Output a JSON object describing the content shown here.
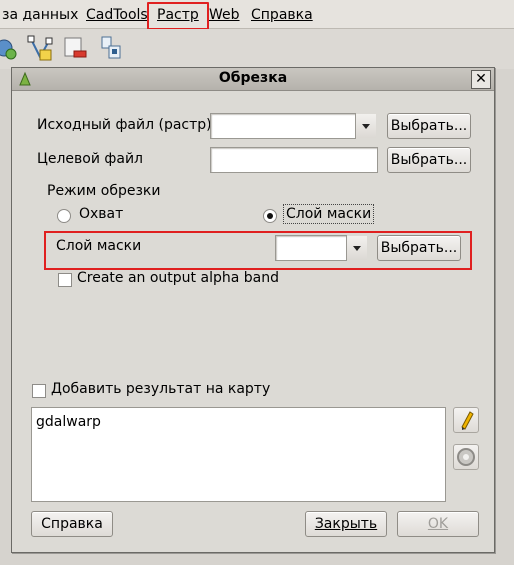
{
  "menubar": {
    "items": [
      {
        "label": "за данных"
      },
      {
        "label": "CadTools"
      },
      {
        "label": "Растр"
      },
      {
        "label": "Web"
      },
      {
        "label": "Справка"
      }
    ]
  },
  "dialog": {
    "title": "Обрезка",
    "close_glyph": "✕",
    "source_file": {
      "label": "Исходный файл (растр)",
      "value": "",
      "button": "Выбрать..."
    },
    "target_file": {
      "label": "Целевой файл",
      "value": "",
      "button": "Выбрать..."
    },
    "clip_mode": {
      "label": "Режим обрезки",
      "options": [
        {
          "label": "Охват",
          "selected": false
        },
        {
          "label": "Слой маски",
          "selected": true
        }
      ]
    },
    "mask_layer": {
      "label": "Слой маски",
      "value": "",
      "button": "Выбрать..."
    },
    "alpha_band": {
      "label": "Create an output alpha band",
      "checked": false
    },
    "add_to_map": {
      "label": "Добавить результат на карту",
      "checked": false
    },
    "command": "gdalwarp",
    "buttons": {
      "help": "Справка",
      "close": "Закрыть",
      "ok": "OK"
    }
  },
  "icons": {
    "app": "qgis-icon",
    "edit": "pencil-icon",
    "reset": "reset-icon"
  },
  "colors": {
    "highlight": "#e02020"
  }
}
